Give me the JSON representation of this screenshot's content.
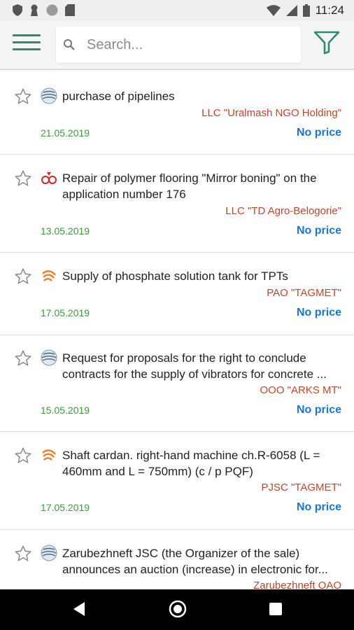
{
  "status_bar": {
    "time": "11:24",
    "icons_left": [
      "shield-icon",
      "keyhole-icon",
      "circle-icon",
      "sd-card-icon"
    ],
    "icons_right": [
      "wifi-icon",
      "signal-icon",
      "battery-icon"
    ]
  },
  "toolbar": {
    "search_placeholder": "Search...",
    "search_value": "",
    "accent_color": "#2e8b6e"
  },
  "items": [
    {
      "title": "purchase of pipelines",
      "organization": "LLC \"Uralmash NGO Holding\"",
      "date": "21.05.2019",
      "price": "No price",
      "source_icon": "globe-icon"
    },
    {
      "title": "Repair of polymer flooring \"Mirror boning\" on the application number 176",
      "organization": "LLC \"TD Agro-Belogorie\"",
      "date": "13.05.2019",
      "price": "No price",
      "source_icon": "red-logo-icon"
    },
    {
      "title": "Supply of phosphate solution tank for TPTs",
      "organization": "PAO \"TAGMET\"",
      "date": "17.05.2019",
      "price": "No price",
      "source_icon": "orange-logo-icon"
    },
    {
      "title": "Request for proposals for the right to conclude contracts for the supply of vibrators for concrete ...",
      "organization": "OOO \"ARKS MT\"",
      "date": "15.05.2019",
      "price": "No price",
      "source_icon": "globe-icon"
    },
    {
      "title": "Shaft cardan. right-hand machine ch.R-6058 (L = 460mm and L = 750mm) (c / p PQF)",
      "organization": "PJSC \"TAGMET\"",
      "date": "17.05.2019",
      "price": "No price",
      "source_icon": "orange-logo-icon"
    },
    {
      "title": "Zarubezhneft JSC (the Organizer of the sale) announces an auction (increase) in electronic for...",
      "organization": "Zarubezhneft OAO",
      "date": "",
      "price": "",
      "source_icon": "globe-icon"
    }
  ],
  "colors": {
    "organization": "#c0452a",
    "date": "#3d9a3a",
    "price": "#1976d2"
  },
  "nav_bar": {
    "icons": [
      "back-icon",
      "home-icon",
      "recents-icon"
    ]
  }
}
